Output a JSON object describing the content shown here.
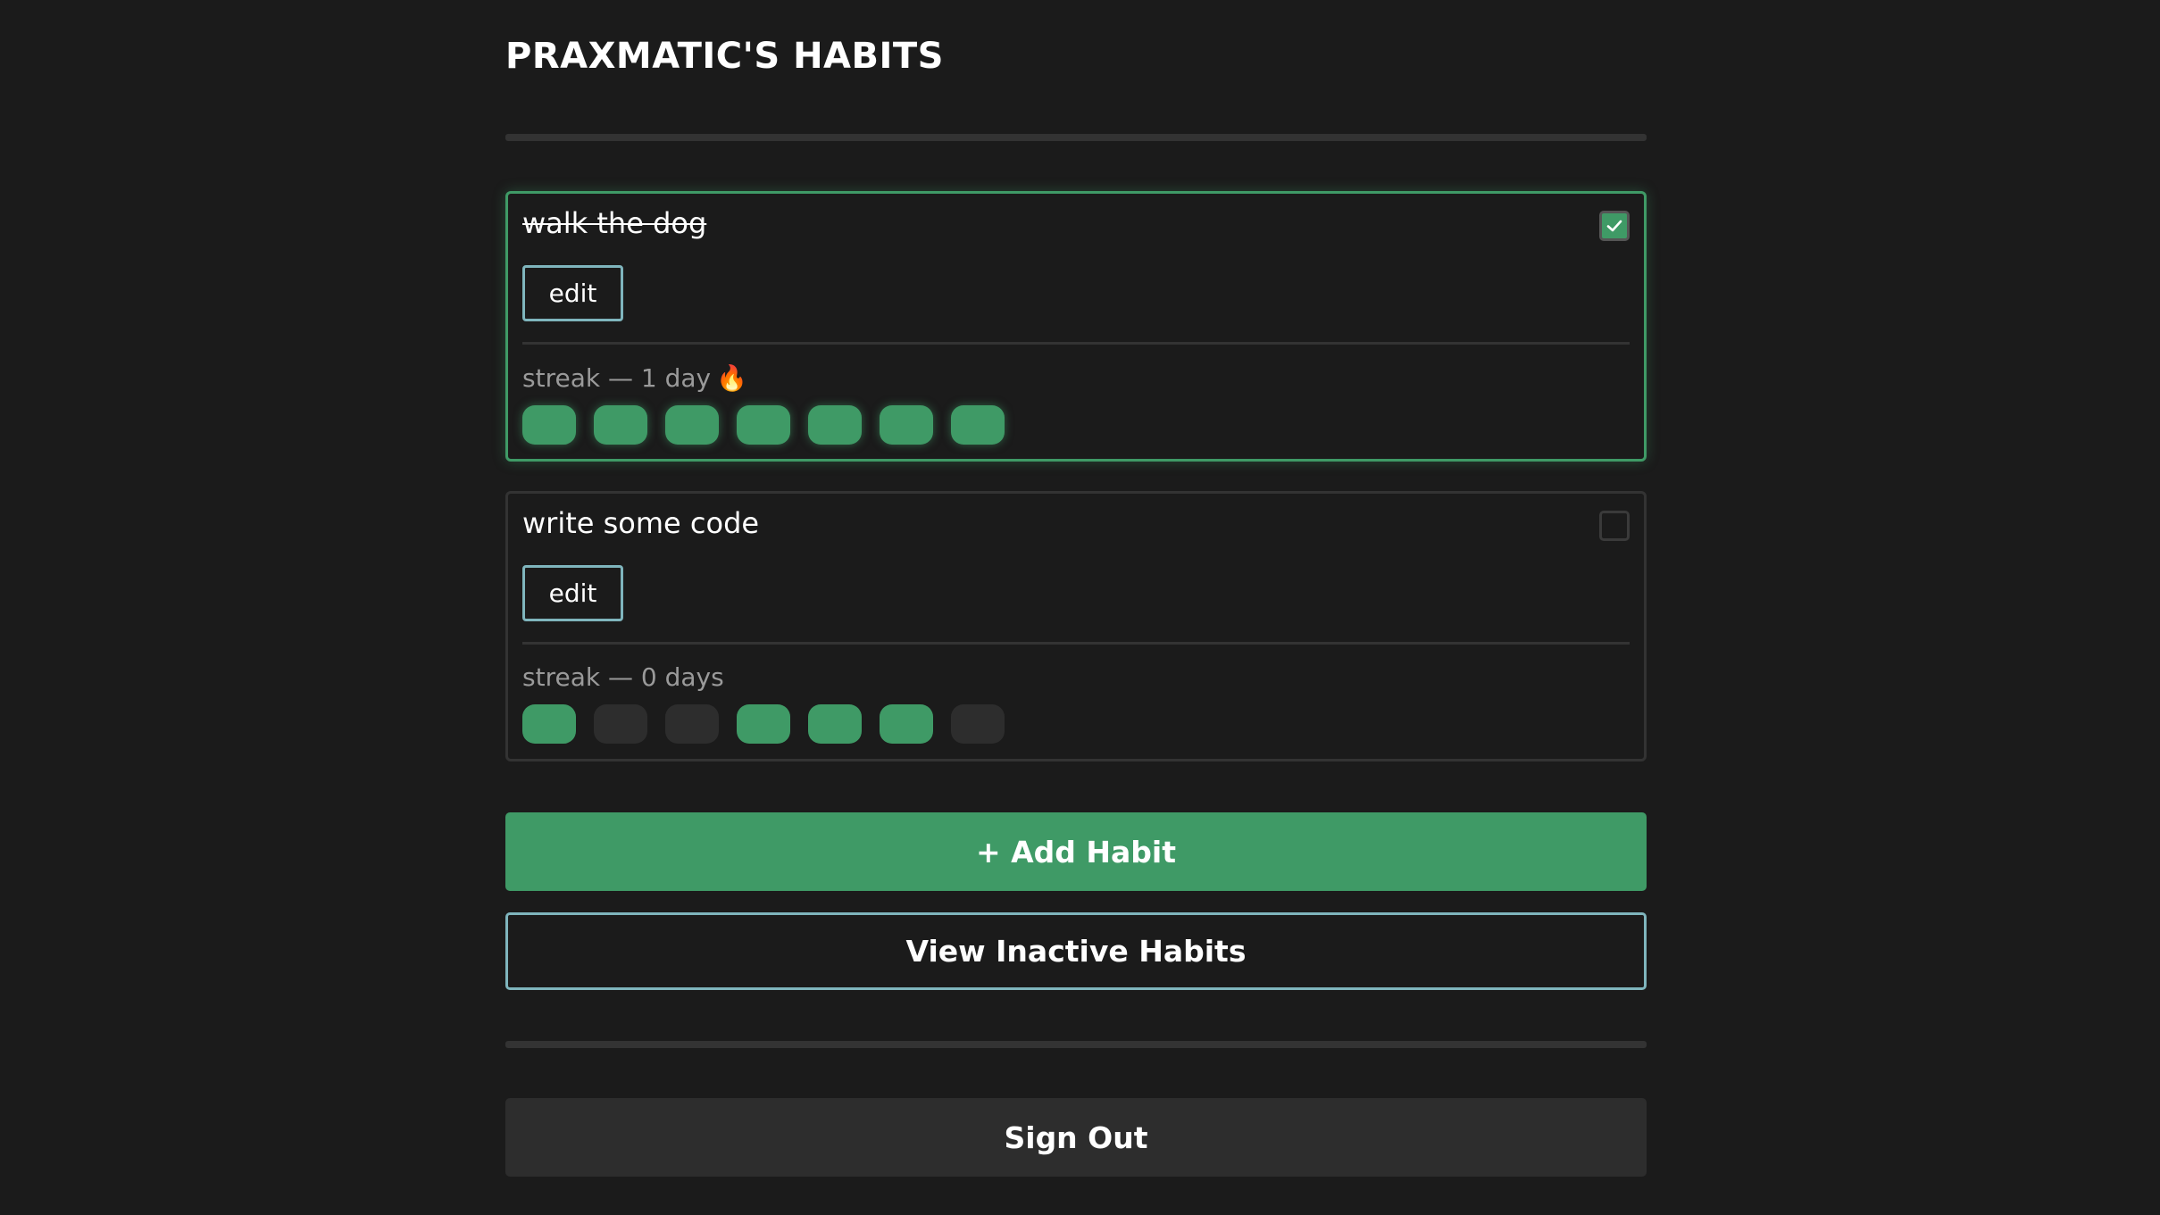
{
  "header": {
    "title": "PRAXMATIC'S HABITS"
  },
  "habits": [
    {
      "name": "walk the dog",
      "completed": true,
      "edit_label": "edit",
      "streak_text": "streak — 1 day",
      "streak_icon": "🔥",
      "week": [
        true,
        true,
        true,
        true,
        true,
        true,
        true
      ]
    },
    {
      "name": "write some code",
      "completed": false,
      "edit_label": "edit",
      "streak_text": "streak — 0 days",
      "streak_icon": "",
      "week": [
        true,
        false,
        false,
        true,
        true,
        true,
        false
      ]
    }
  ],
  "actions": {
    "add_label": "+ Add Habit",
    "inactive_label": "View Inactive Habits",
    "signout_label": "Sign Out"
  },
  "colors": {
    "background": "#1b1b1b",
    "accent_green": "#3f9a66",
    "outline_teal": "#7fb5bd",
    "muted_surface": "#2d2d2d"
  }
}
